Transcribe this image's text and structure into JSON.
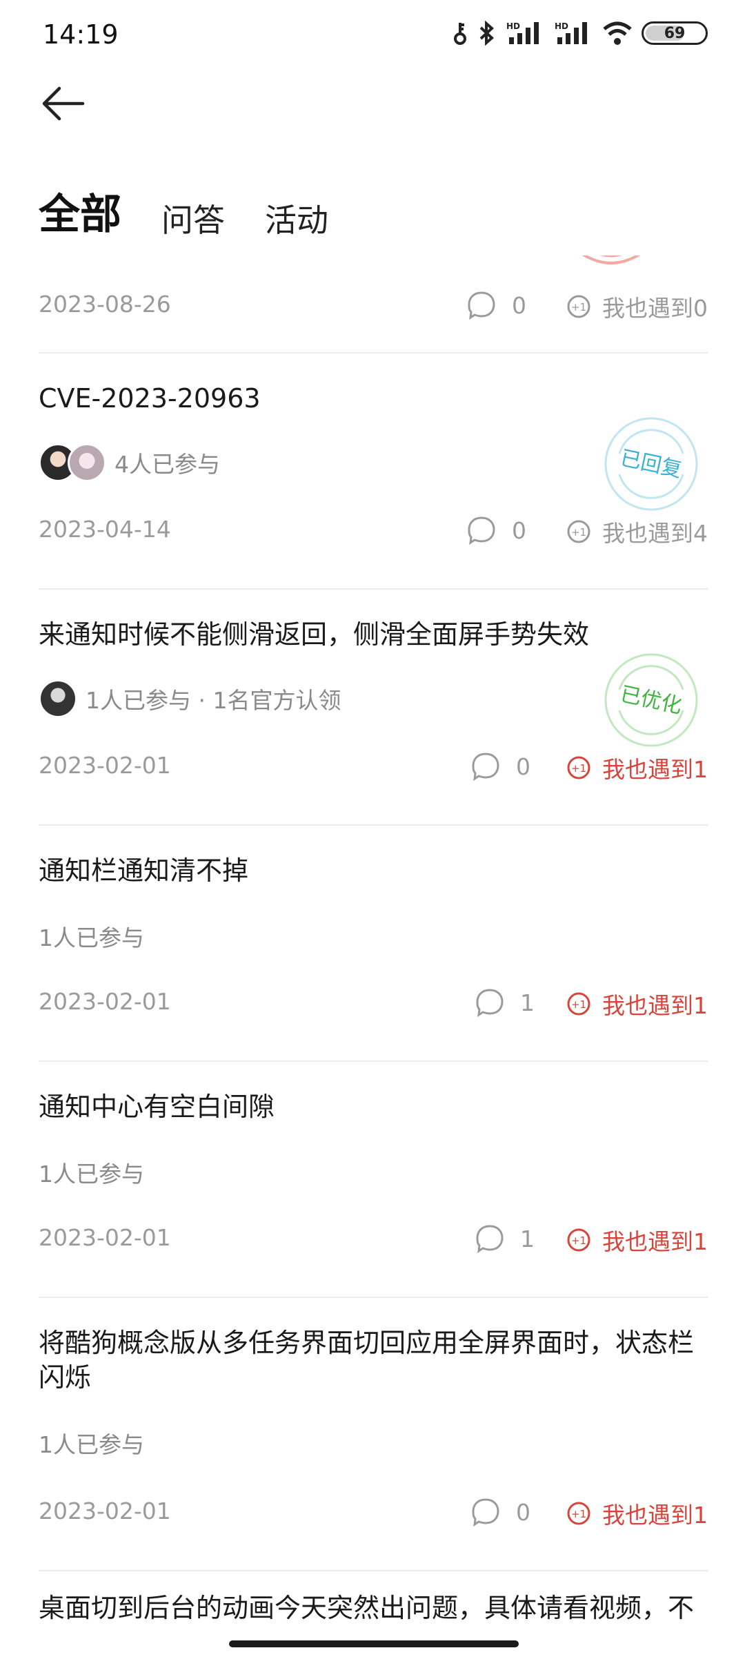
{
  "status_bar": {
    "time": "14:19",
    "battery": "69"
  },
  "tabs": [
    {
      "label": "全部"
    },
    {
      "label": "问答"
    },
    {
      "label": "活动"
    }
  ],
  "items": [
    {
      "title": "",
      "meta": "",
      "date": "2023-08-26",
      "comments": "0",
      "metoo": "我也遇到0",
      "metoo_active": false
    },
    {
      "title": "CVE-2023-20963",
      "meta": "4人已参与",
      "stamp": "已回复",
      "stamp_color": "#3bb0d6",
      "date": "2023-04-14",
      "comments": "0",
      "metoo": "我也遇到4",
      "metoo_active": false
    },
    {
      "title": "来通知时候不能侧滑返回，侧滑全面屏手势失效",
      "meta": "1人已参与 · 1名官方认领",
      "stamp": "已优化",
      "stamp_color": "#3fb63f",
      "date": "2023-02-01",
      "comments": "0",
      "metoo": "我也遇到1",
      "metoo_active": true
    },
    {
      "title": "通知栏通知清不掉",
      "meta": "1人已参与",
      "date": "2023-02-01",
      "comments": "1",
      "metoo": "我也遇到1",
      "metoo_active": true
    },
    {
      "title": "通知中心有空白间隙",
      "meta": "1人已参与",
      "date": "2023-02-01",
      "comments": "1",
      "metoo": "我也遇到1",
      "metoo_active": true
    },
    {
      "title": "将酷狗概念版从多任务界面切回应用全屏界面时，状态栏闪烁",
      "meta": "1人已参与",
      "date": "2023-02-01",
      "comments": "0",
      "metoo": "我也遇到1",
      "metoo_active": true
    },
    {
      "title": "桌面切到后台的动画今天突然出问题，具体请看视频，不",
      "meta": "",
      "date": "",
      "comments": "",
      "metoo": "",
      "metoo_active": false
    }
  ],
  "colors": {
    "accent_red": "#d9443a",
    "muted": "#9a9a9a",
    "divider": "#ececec"
  }
}
